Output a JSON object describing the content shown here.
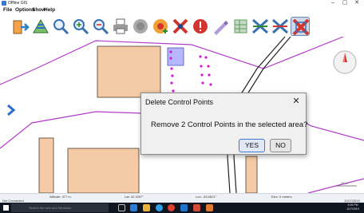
{
  "window": {
    "title": "Offline GIS",
    "minimize": "–",
    "maximize": "▢",
    "close": "✕"
  },
  "menu": [
    {
      "label": "File"
    },
    {
      "label": "Options"
    },
    {
      "label": "Show"
    },
    {
      "label": "Help"
    }
  ],
  "toolbar": [
    {
      "icon": "exit-icon",
      "color": "#2a7fc0"
    },
    {
      "icon": "layers-icon",
      "color": "#4d9b3a"
    },
    {
      "icon": "zoom-icon",
      "color": "#3a6fb0"
    },
    {
      "icon": "zoom-in-icon",
      "color": "#3a6fb0"
    },
    {
      "icon": "zoom-out-icon",
      "color": "#3a6fb0"
    },
    {
      "icon": "print-icon",
      "color": "#7a7a7a"
    },
    {
      "icon": "globe-icon",
      "color": "#8a8a8a"
    },
    {
      "icon": "add-point-icon",
      "color": "#e0812a"
    },
    {
      "icon": "delete-point-icon",
      "color": "#d2352e"
    },
    {
      "icon": "alert-icon",
      "color": "#d2352e"
    },
    {
      "icon": "edit-icon",
      "color": "#8b6bb8"
    },
    {
      "icon": "grid-icon",
      "color": "#5aa05a"
    },
    {
      "icon": "move-points-icon",
      "color": "#3a6fb0"
    },
    {
      "icon": "select-points-icon",
      "color": "#3a6fb0"
    },
    {
      "icon": "delete-area-icon",
      "color": "#d2352e"
    }
  ],
  "map": {
    "scale_label": "25 m",
    "colors": {
      "road": "#b23cc8",
      "building": "#f4cba6",
      "building_stroke": "#4a3a2a",
      "selection": "#b7b7ff",
      "points": "#d21ad6",
      "nav_arrow": "#2a6fcf"
    }
  },
  "status": {
    "connection": "Not Connected",
    "altitude": "Altitude: 377 m",
    "latitude": "Lat: 42.3297°",
    "longitude": "Lon: -83.0621°",
    "elevation": "Elev: 0 meters",
    "timestamp": "11/07/2019"
  },
  "taskbar": {
    "search_placeholder": "Search the web and Windows",
    "time": "4:06 PM",
    "date": "11/7/2019"
  },
  "dialog": {
    "title": "Delete Control Points",
    "message": "Remove 2 Control Points in the selected area?",
    "yes_label": "YES",
    "no_label": "NO",
    "close": "✕"
  }
}
